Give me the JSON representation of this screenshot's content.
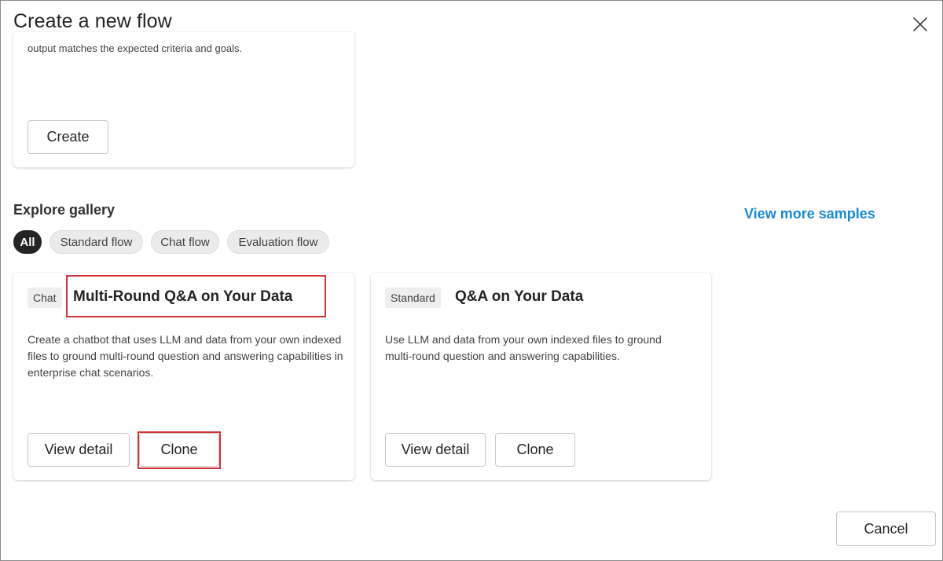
{
  "dialog": {
    "title": "Create a new flow",
    "close_icon": "close-icon"
  },
  "top_card": {
    "description": "output matches the expected criteria and goals.",
    "create_label": "Create"
  },
  "gallery": {
    "title": "Explore gallery",
    "view_more_label": "View more samples",
    "filters": [
      {
        "label": "All",
        "active": true
      },
      {
        "label": "Standard flow",
        "active": false
      },
      {
        "label": "Chat flow",
        "active": false
      },
      {
        "label": "Evaluation flow",
        "active": false
      }
    ],
    "cards": [
      {
        "tag": "Chat",
        "title": "Multi-Round Q&A on Your Data",
        "description": "Create a chatbot that uses LLM and data from your own indexed files to ground multi-round question and answering capabilities in enterprise chat scenarios.",
        "view_detail_label": "View detail",
        "clone_label": "Clone"
      },
      {
        "tag": "Standard",
        "title": "Q&A on Your Data",
        "description": "Use LLM and data from your own indexed files to ground multi-round question and answering capabilities.",
        "view_detail_label": "View detail",
        "clone_label": "Clone"
      }
    ]
  },
  "footer": {
    "cancel_label": "Cancel"
  },
  "colors": {
    "accent_link": "#1a8ad4",
    "highlight_box": "#d13438",
    "active_filter": "#242424"
  }
}
